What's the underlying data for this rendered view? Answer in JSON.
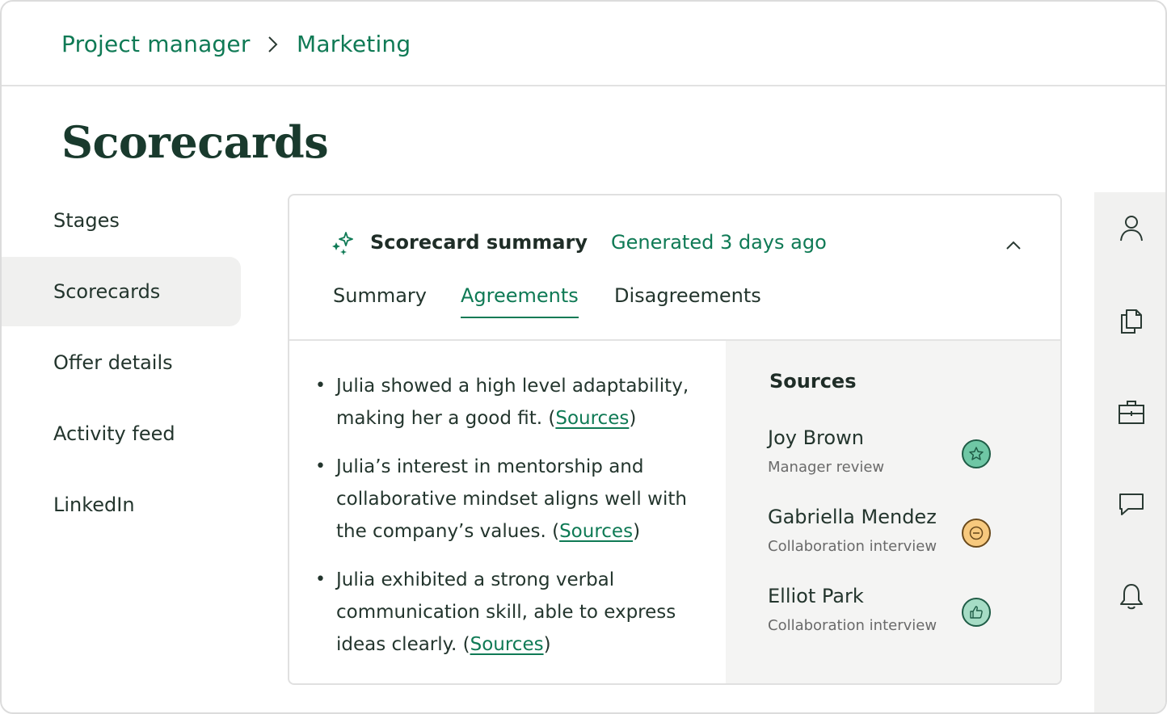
{
  "breadcrumb": {
    "items": [
      "Project manager",
      "Marketing"
    ]
  },
  "page": {
    "title": "Scorecards"
  },
  "nav": {
    "items": [
      {
        "label": "Stages"
      },
      {
        "label": "Scorecards",
        "active": true
      },
      {
        "label": "Offer details"
      },
      {
        "label": "Activity feed"
      },
      {
        "label": "LinkedIn"
      }
    ]
  },
  "summary_card": {
    "title": "Scorecard summary",
    "generated": "Generated 3 days ago",
    "tabs": [
      {
        "label": "Summary"
      },
      {
        "label": "Agreements",
        "active": true
      },
      {
        "label": "Disagreements"
      }
    ],
    "points": [
      {
        "text_before": "Julia showed a high level adaptability, making her a good fit. (",
        "link": "Sources",
        "text_after": ")"
      },
      {
        "text_before": "Julia’s interest in mentorship and collaborative mindset aligns well with the company’s values. (",
        "link": "Sources",
        "text_after": ")"
      },
      {
        "text_before": "Julia exhibited a strong verbal communication skill, able to express ideas clearly. (",
        "link": "Sources",
        "text_after": ")"
      }
    ],
    "sources": {
      "title": "Sources",
      "items": [
        {
          "name": "Joy Brown",
          "role": "Manager review",
          "icon": "star-icon"
        },
        {
          "name": "Gabriella Mendez",
          "role": "Collaboration interview",
          "icon": "minus-icon"
        },
        {
          "name": "Elliot Park",
          "role": "Collaboration interview",
          "icon": "thumbs-up-icon"
        }
      ]
    }
  },
  "colors": {
    "accent": "#0f7a55",
    "title": "#193a2d",
    "text": "#23352d",
    "muted": "#6a6a6a",
    "panel": "#f4f4f3"
  }
}
